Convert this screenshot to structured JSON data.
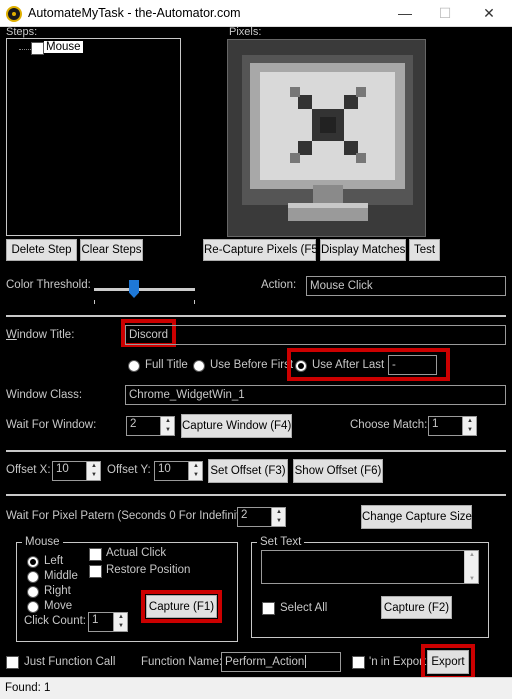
{
  "window": {
    "title": "AutomateMyTask - the-Automator.com",
    "minimize": "—",
    "maximize": "☐",
    "close": "✕"
  },
  "steps": {
    "label": "Steps:",
    "tree_item": "Mouse",
    "delete_button": "Delete Step",
    "clear_button": "Clear Steps"
  },
  "pixels": {
    "label": "Pixels:",
    "recapture_button": "Re-Capture Pixels (F5)",
    "display_matches_button": "Display Matches",
    "test_button": "Test"
  },
  "color_threshold": {
    "label": "Color Threshold:",
    "level": 0.38
  },
  "action": {
    "label": "Action:",
    "value": "Mouse Click"
  },
  "window_title": {
    "label": "Window Title:",
    "value": "Discord",
    "full_title": "Full Title",
    "use_before_first": "Use Before First",
    "use_after_last": "Use After Last",
    "after_last_value": "-",
    "selected": "use_after_last"
  },
  "window_class": {
    "label": "Window Class:",
    "value": "Chrome_WidgetWin_1"
  },
  "wait_for_window": {
    "label": "Wait For Window:",
    "value": "2",
    "capture_button": "Capture Window (F4)",
    "choose_match_label": "Choose Match:",
    "choose_match_value": "1"
  },
  "offset": {
    "x_label": "Offset X:",
    "x_value": "10",
    "y_label": "Offset Y:",
    "y_value": "10",
    "set_button": "Set Offset (F3)",
    "show_button": "Show Offset (F6)"
  },
  "wait_pixel": {
    "label": "Wait For Pixel Patern (Seconds 0 For Indefinite):",
    "value": "2",
    "change_size_button": "Change Capture Size"
  },
  "mouse": {
    "legend": "Mouse",
    "options": [
      "Left",
      "Middle",
      "Right",
      "Move"
    ],
    "selected": "Left",
    "actual_click": "Actual Click",
    "restore_position": "Restore Position",
    "click_count_label": "Click Count:",
    "click_count_value": "1",
    "capture_button": "Capture (F1)"
  },
  "set_text": {
    "legend": "Set Text",
    "value": "",
    "select_all": "Select All",
    "capture_button": "Capture (F2)"
  },
  "bottom": {
    "just_function_call": "Just Function Call",
    "function_name_label": "Function Name:",
    "function_name_value": "Perform_Action",
    "in_export_label": "'n in Export",
    "export_button": "Export"
  },
  "status": {
    "text": "Found: 1"
  },
  "colors": {
    "background": "#000000",
    "highlight": "#cc0000"
  }
}
